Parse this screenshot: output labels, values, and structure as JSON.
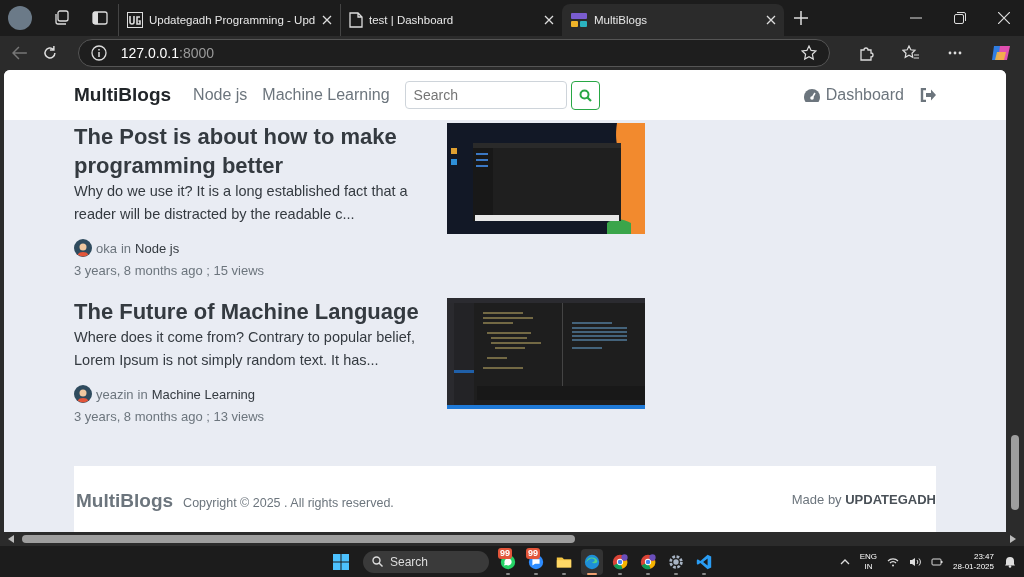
{
  "browser": {
    "tabs": [
      {
        "kind": "logo",
        "title": "Updategadh Programming - Upd",
        "selected": false
      },
      {
        "kind": "page",
        "title": "test | Dashboard",
        "selected": false
      },
      {
        "kind": "blogs",
        "title": "MultiBlogs",
        "selected": true
      }
    ],
    "address": {
      "host": "127.0.0.1",
      "port": ":8000"
    }
  },
  "navbar": {
    "brand": "MultiBlogs",
    "links": [
      "Node js",
      "Machine Learning"
    ],
    "search": {
      "placeholder": "Search"
    },
    "dashboard": "Dashboard"
  },
  "posts": [
    {
      "title": "The Post is about how to make programming better",
      "excerpt": "Why do we use it? It is a long established fact that a reader will be distracted by the readable c...",
      "author": "oka",
      "preposition": "in",
      "category": "Node js",
      "meta": "3 years, 8 months ago ; 15 views"
    },
    {
      "title": "The Future of Machine Language",
      "excerpt": "Where does it come from? Contrary to popular belief, Lorem Ipsum is not simply random text. It has...",
      "author": "yeazin",
      "preposition": "in",
      "category": "Machine Learning",
      "meta": "3 years, 8 months ago ; 13 views"
    }
  ],
  "footer": {
    "brand": "MultiBlogs",
    "copyright": "Copyright © 2025 . All rights reserved.",
    "credit": "Made by **UPDATEGADH**"
  },
  "taskbar": {
    "search": "Search",
    "apps": [
      {
        "kind": "whatsapp",
        "badge": "99",
        "selected": false
      },
      {
        "kind": "chat",
        "badge": "99",
        "selected": false
      },
      {
        "kind": "folder",
        "selected": false
      },
      {
        "kind": "edge",
        "selected": true
      },
      {
        "kind": "chrome",
        "selected": false
      },
      {
        "kind": "chrome",
        "selected": false
      },
      {
        "kind": "settings",
        "selected": false
      },
      {
        "kind": "vscode",
        "selected": false
      }
    ],
    "language": "ENG",
    "region": "IN",
    "time": "23:47",
    "date": "28-01-2025"
  }
}
